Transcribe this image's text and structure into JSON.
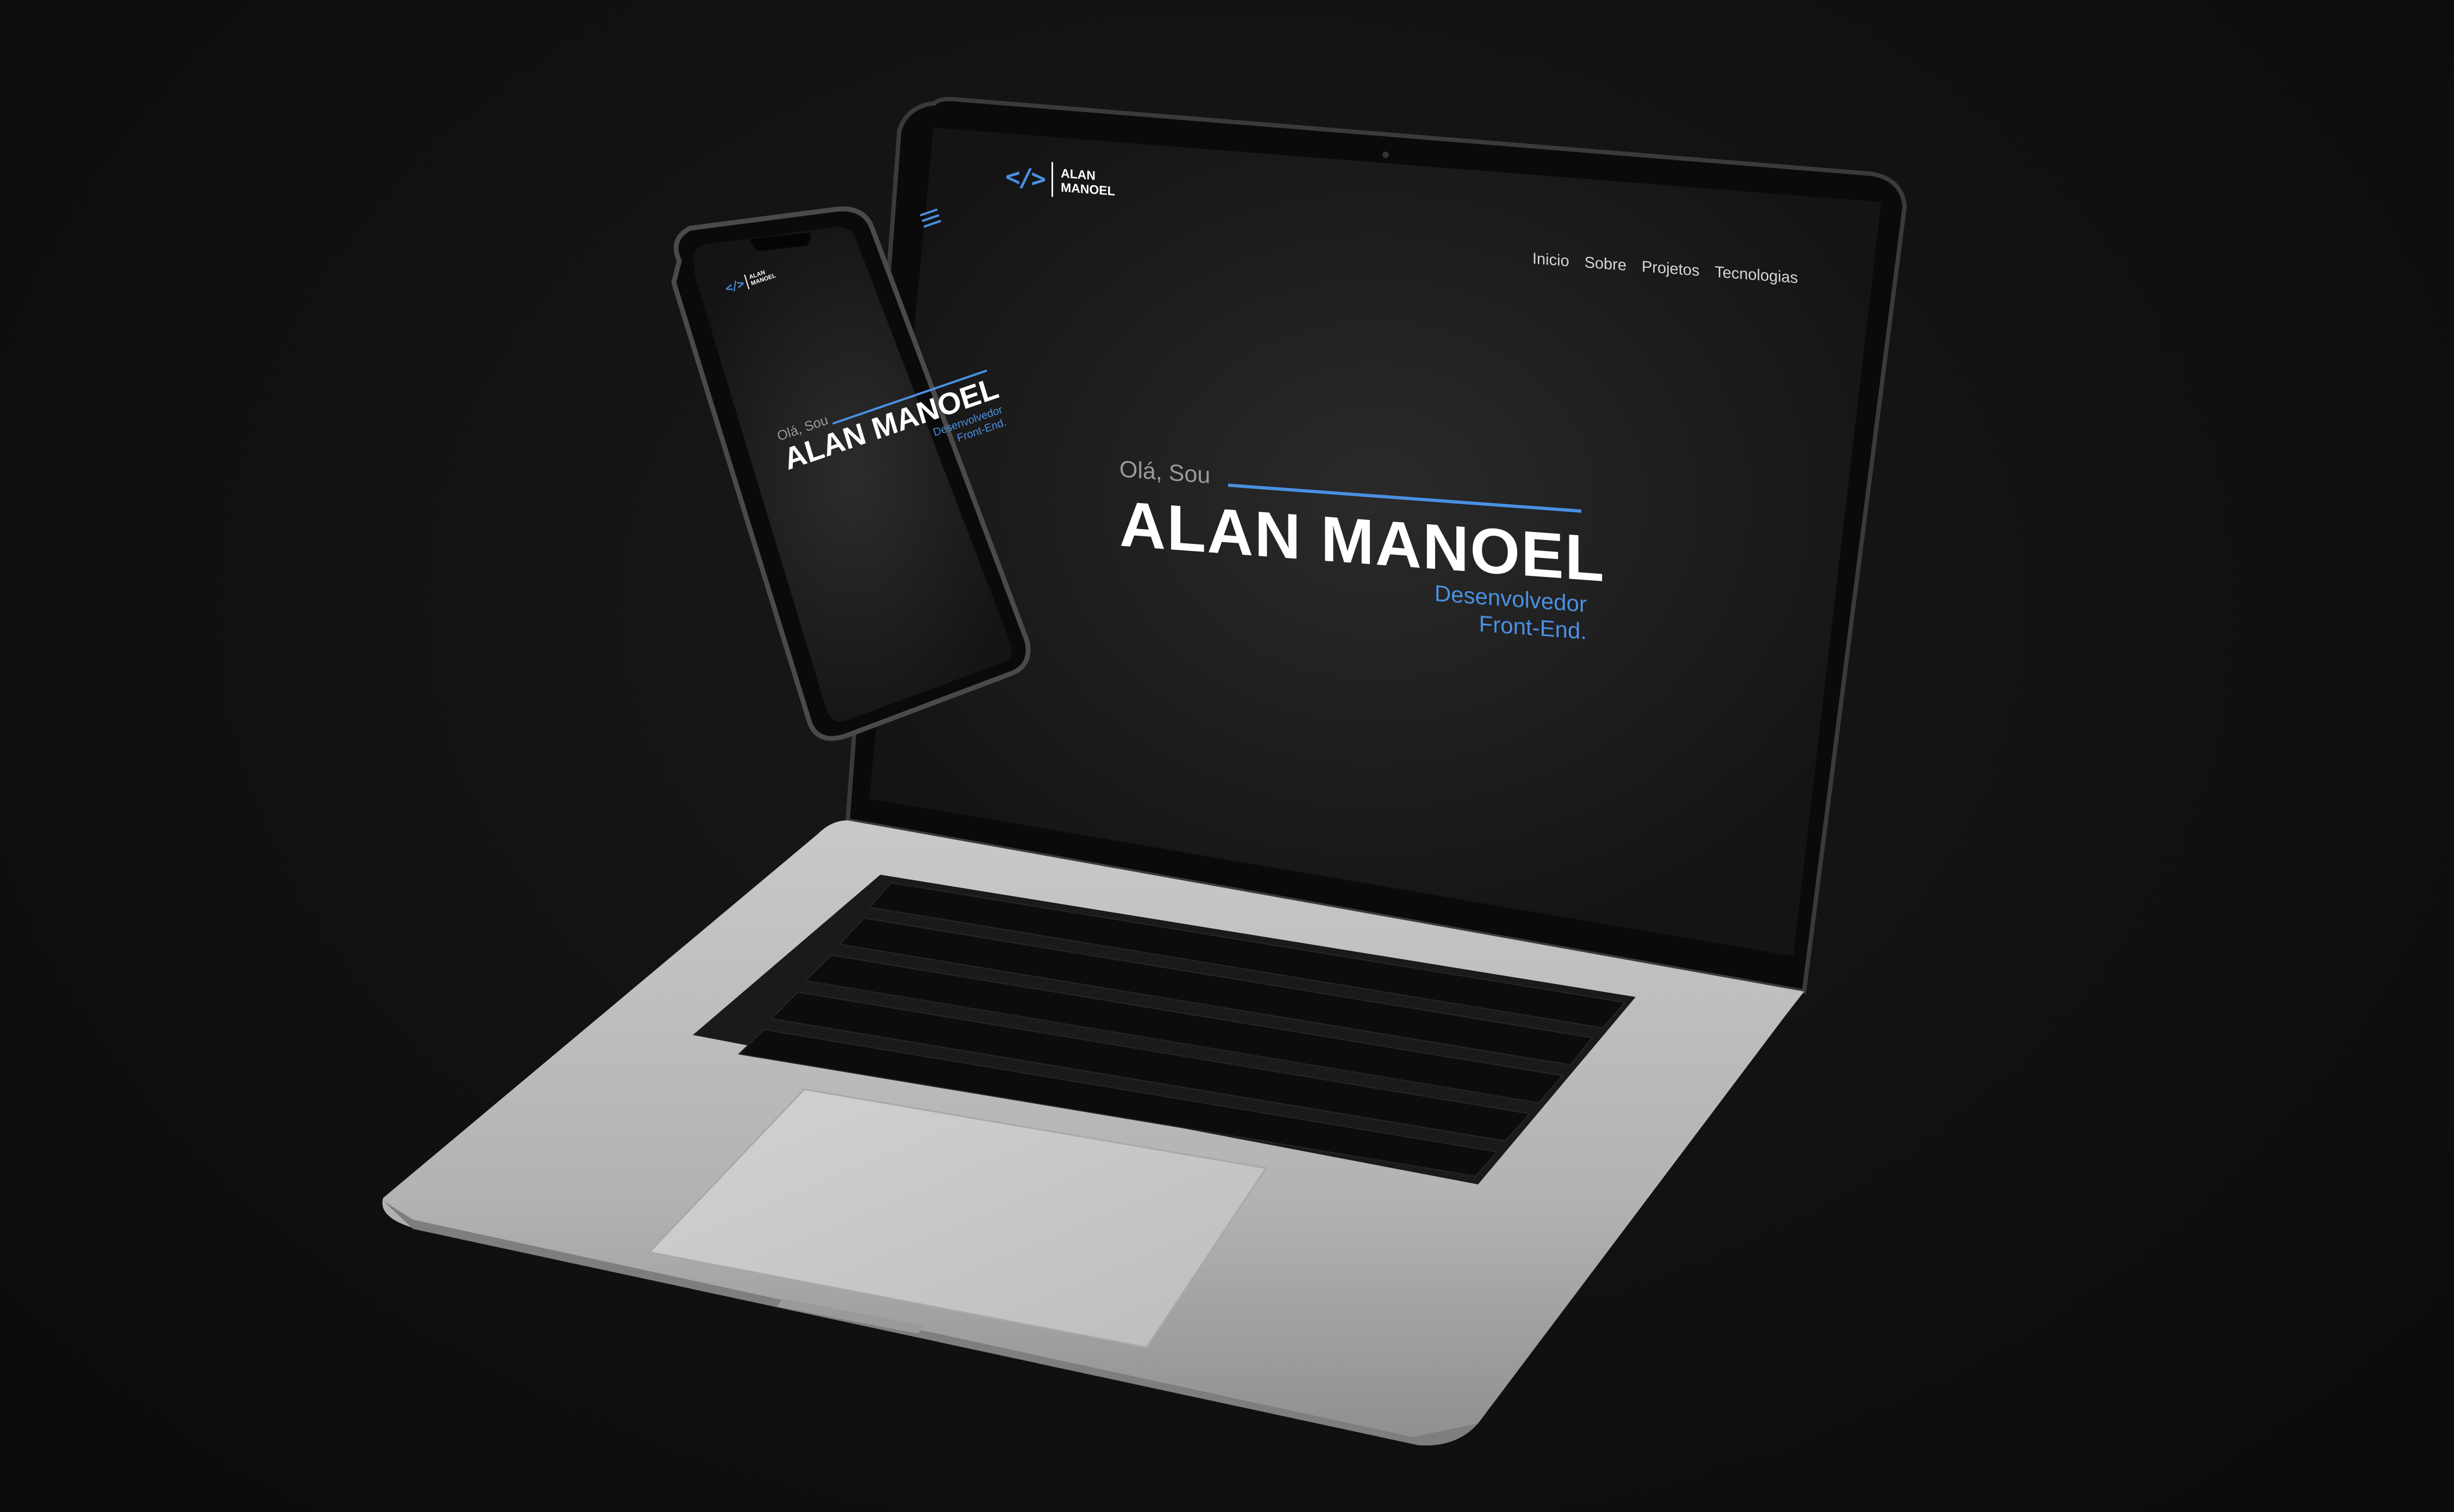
{
  "site": {
    "logo": {
      "code": "</>",
      "line1": "ALAN",
      "line2": "MANOEL"
    },
    "nav": [
      {
        "label": "Inicio"
      },
      {
        "label": "Sobre"
      },
      {
        "label": "Projetos"
      },
      {
        "label": "Tecnologias"
      }
    ],
    "hero": {
      "greeting": "Olá, Sou",
      "name": "ALAN MANOEL",
      "role_line1": "Desenvolvedor",
      "role_line2": "Front-End."
    }
  },
  "colors": {
    "accent": "#4a90e2",
    "background": "#111111",
    "device_silver": "#b8b8b8"
  }
}
